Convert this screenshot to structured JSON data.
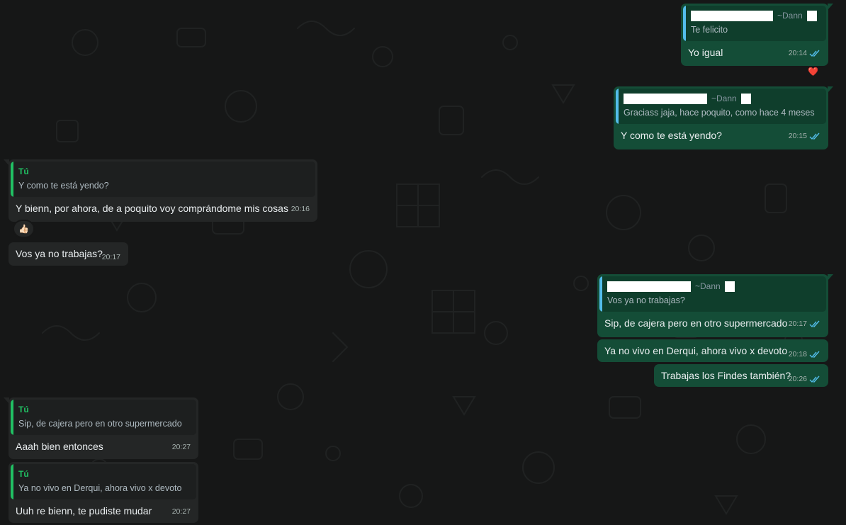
{
  "colors": {
    "background": "#161717",
    "incoming_bubble": "#242626",
    "outgoing_bubble": "#144d37",
    "quote_bar_incoming": "#21c063",
    "quote_bar_outgoing": "#53bdeb",
    "read_ticks": "#53bdeb"
  },
  "messages": [
    {
      "direction": "out",
      "quote_name": "~Dann",
      "quote_text": "Te felicito",
      "text": "Yo igual",
      "time": "20:14",
      "status_icon": "double-check-read-icon",
      "reaction": "red-heart-icon",
      "reaction_glyph": "❤️"
    },
    {
      "direction": "out",
      "quote_name": "~Dann",
      "quote_text": "Graciass jaja, hace poquito, como hace 4 meses",
      "text": "Y como te está yendo?",
      "time": "20:15",
      "status_icon": "double-check-read-icon"
    },
    {
      "direction": "in",
      "quote_author": "Tú",
      "quote_text": "Y como te está yendo?",
      "text": "Y bienn, por ahora, de a poquito voy comprándome mis cosas",
      "time": "20:16",
      "reaction": "thumbs-up-icon",
      "reaction_glyph": "👍🏻"
    },
    {
      "direction": "in",
      "text": "Vos ya no trabajas?",
      "time": "20:17"
    },
    {
      "direction": "out",
      "quote_name": "~Dann",
      "quote_text": "Vos ya no trabajas?",
      "text": "Sip, de cajera pero en otro supermercado",
      "time": "20:17",
      "status_icon": "double-check-read-icon"
    },
    {
      "direction": "out",
      "text": "Ya no vivo en Derqui, ahora vivo x devoto",
      "time": "20:18",
      "status_icon": "double-check-read-icon"
    },
    {
      "direction": "out",
      "text": "Trabajas los Findes también?",
      "time": "20:26",
      "status_icon": "double-check-read-icon"
    },
    {
      "direction": "in",
      "quote_author": "Tú",
      "quote_text": "Sip, de cajera pero en otro supermercado",
      "text": "Aaah bien entonces",
      "time": "20:27"
    },
    {
      "direction": "in",
      "quote_author": "Tú",
      "quote_text": "Ya no vivo en Derqui, ahora vivo x devoto",
      "text": "Uuh re bienn, te pudiste mudar",
      "time": "20:27"
    }
  ]
}
